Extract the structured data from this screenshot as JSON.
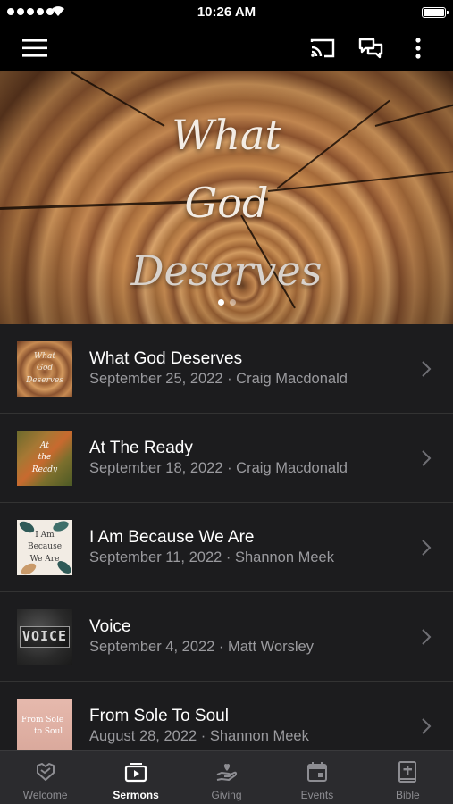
{
  "status_bar": {
    "time": "10:26 AM"
  },
  "hero": {
    "title_lines": [
      "What",
      "God",
      "Deserves"
    ],
    "pages": 2,
    "current_page": 1
  },
  "sermons": [
    {
      "title": "What God Deserves",
      "meta": "September 25, 2022 · Craig Macdonald",
      "thumb_text": [
        "What",
        "God",
        "Deserves"
      ]
    },
    {
      "title": "At The Ready",
      "meta": "September 18, 2022 · Craig Macdonald",
      "thumb_text": [
        "At",
        "the",
        "Ready"
      ]
    },
    {
      "title": "I Am Because We Are",
      "meta": "September 11, 2022 · Shannon Meek",
      "thumb_text": [
        "I Am Because",
        "We Are"
      ]
    },
    {
      "title": "Voice",
      "meta": "September 4, 2022 · Matt Worsley",
      "thumb_text": [
        "VOICE"
      ]
    },
    {
      "title": "From Sole To Soul",
      "meta": "August 28, 2022 · Shannon Meek",
      "thumb_text": [
        "From Sole",
        "to Soul"
      ]
    }
  ],
  "tabs": [
    {
      "label": "Welcome",
      "icon": "heart-hands-icon",
      "active": false
    },
    {
      "label": "Sermons",
      "icon": "play-video-icon",
      "active": true
    },
    {
      "label": "Giving",
      "icon": "giving-hand-icon",
      "active": false
    },
    {
      "label": "Events",
      "icon": "calendar-icon",
      "active": false
    },
    {
      "label": "Bible",
      "icon": "bible-icon",
      "active": false
    }
  ],
  "colors": {
    "background": "#1c1c1e",
    "tab_active": "#ffffff",
    "tab_inactive": "#8d8d92",
    "meta_text": "#9a9a9e"
  }
}
